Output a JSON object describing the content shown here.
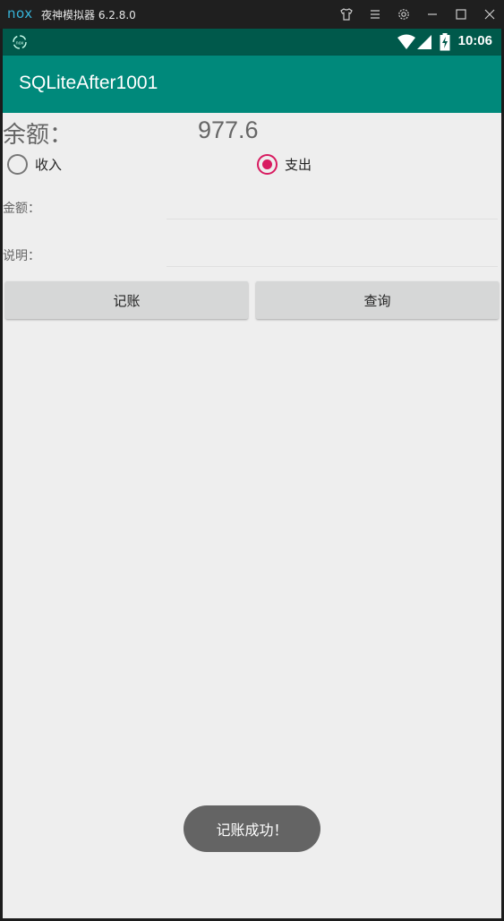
{
  "emulator": {
    "logo": "nox",
    "title": "夜神模拟器 6.2.8.0",
    "controls": [
      "shirt-icon",
      "menu-icon",
      "gear-icon",
      "minimize-icon",
      "maximize-icon",
      "close-icon"
    ]
  },
  "status_bar": {
    "time": "10:06",
    "icons": [
      "wifi-icon",
      "signal-icon",
      "battery-charging-icon"
    ]
  },
  "app_bar": {
    "title": "SQLiteAfter1001"
  },
  "balance": {
    "label": "余额：",
    "value": "977.6"
  },
  "type_radio": {
    "options": [
      {
        "label": "收入",
        "checked": false
      },
      {
        "label": "支出",
        "checked": true
      }
    ]
  },
  "form": {
    "amount_label": "金额：",
    "amount_value": "",
    "note_label": "说明：",
    "note_value": ""
  },
  "buttons": {
    "record": "记账",
    "query": "查询"
  },
  "toast": {
    "message": "记账成功！"
  },
  "colors": {
    "app_bar": "#00897b",
    "status_bar": "#00594b",
    "accent": "#d81b60",
    "background": "#eeeeee"
  }
}
